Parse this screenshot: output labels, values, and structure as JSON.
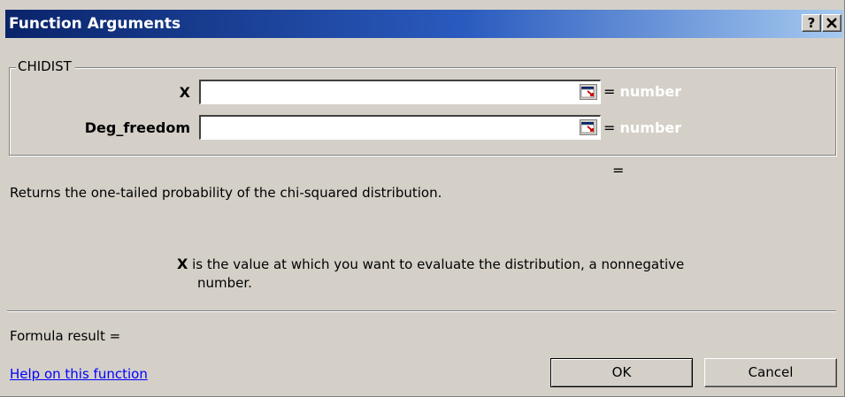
{
  "window": {
    "title": "Function Arguments",
    "help_button": "?",
    "close_button": "✕"
  },
  "function": {
    "name": "CHIDIST",
    "arguments": [
      {
        "label": "X",
        "value": "",
        "hint": "= number"
      },
      {
        "label": "Deg_freedom",
        "value": "",
        "hint": "= number"
      }
    ],
    "result_equals": "=",
    "description": "Returns the one-tailed probability of the chi-squared distribution.",
    "argument_help": {
      "name": "X",
      "text": " is the value at which you want to evaluate the distribution, a nonnegative",
      "text_line2": "number."
    }
  },
  "footer": {
    "formula_result": "Formula result =",
    "help_link": "Help on this function",
    "ok_label": "OK",
    "cancel_label": "Cancel"
  },
  "colors": {
    "titlebar_start": "#0a246a",
    "titlebar_end": "#a6caf0",
    "dialog_bg": "#d4d0c8",
    "link": "#0000ff"
  }
}
